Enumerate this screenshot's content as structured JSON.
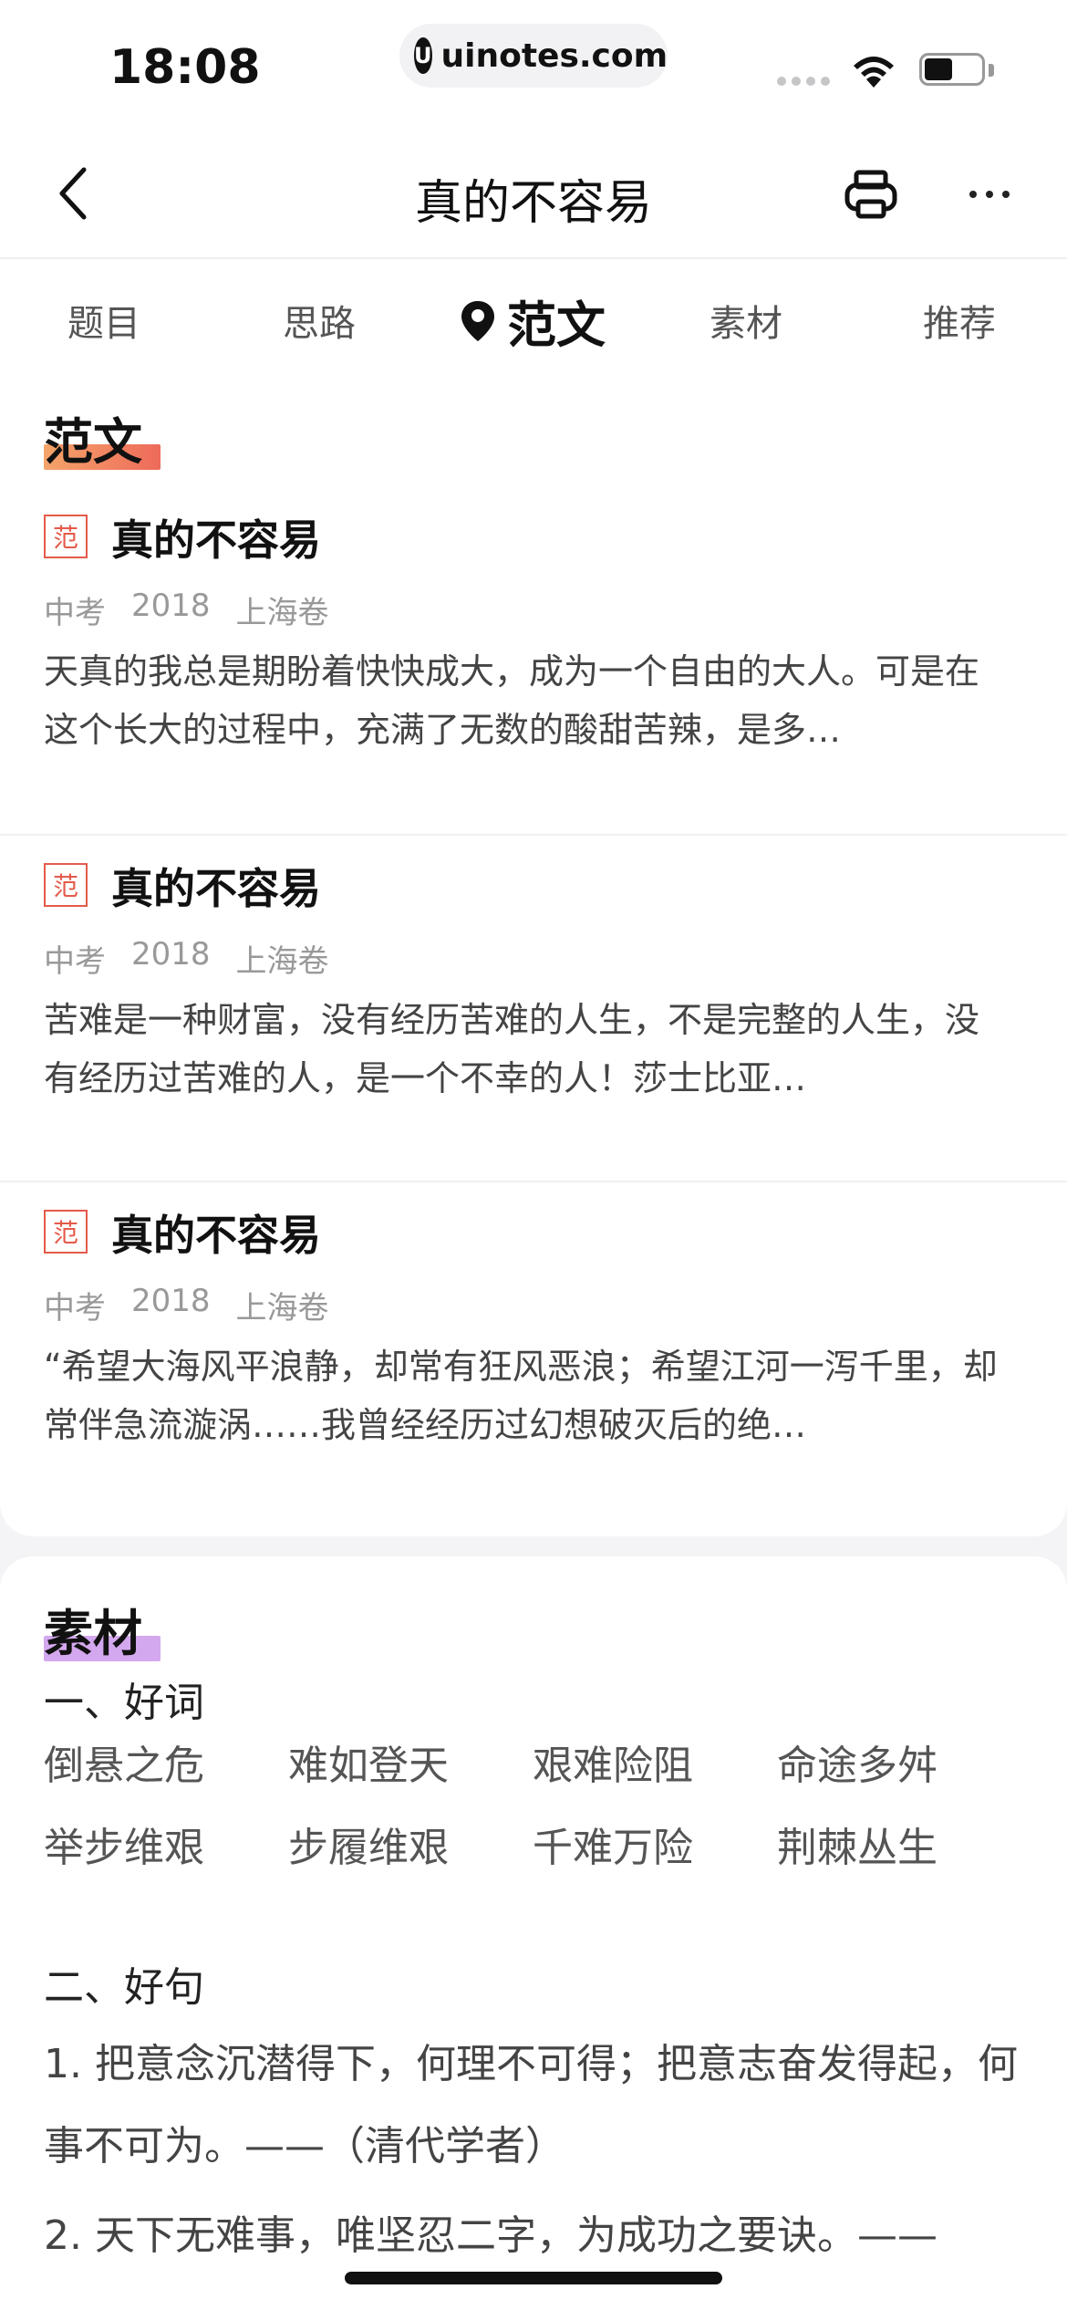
{
  "status_bar": {
    "time": "18:08",
    "url": "uinotes.com",
    "url_logo": "U",
    "battery_level": 0.5
  },
  "nav": {
    "title": "真的不容易",
    "back_icon": "chevron-left-icon",
    "print_icon": "printer-icon",
    "more_icon": "more-horizontal-icon"
  },
  "tabs": [
    {
      "label": "题目"
    },
    {
      "label": "思路"
    },
    {
      "label": "范文",
      "active": true,
      "icon": "location-pin-icon"
    },
    {
      "label": "素材"
    },
    {
      "label": "推荐"
    }
  ],
  "fanwen": {
    "heading": "范文",
    "highlight_color": "#f07a52",
    "essays": [
      {
        "badge": "范",
        "title": "真的不容易",
        "meta": [
          "中考",
          "2018",
          "上海卷"
        ],
        "excerpt": "天真的我总是期盼着快快成大，成为一个自由的大人。可是在这个长大的过程中，充满了无数的酸甜苦辣，是多…"
      },
      {
        "badge": "范",
        "title": "真的不容易",
        "meta": [
          "中考",
          "2018",
          "上海卷"
        ],
        "excerpt": "苦难是一种财富，没有经历苦难的人生，不是完整的人生，没有经历过苦难的人，是一个不幸的人！莎士比亚…"
      },
      {
        "badge": "范",
        "title": "真的不容易",
        "meta": [
          "中考",
          "2018",
          "上海卷"
        ],
        "excerpt": "“希望大海风平浪静，却常有狂风恶浪；希望江河一泻千里，却常伴急流漩涡……我曾经经历过幻想破灭后的绝…"
      }
    ]
  },
  "sucai": {
    "heading": "素材",
    "highlight_color": "#c79be8",
    "good_words_heading": "一、好词",
    "good_words": [
      "倒悬之危",
      "难如登天",
      "艰难险阻",
      "命途多舛",
      "举步维艰",
      "步履维艰",
      "千难万险",
      "荆棘丛生"
    ],
    "good_sentences_heading": "二、好句",
    "sentences": [
      "1. 把意念沉潜得下，何理不可得；把意志奋发得起，何事不可为。——（清代学者）",
      "2. 天下无难事，唯坚忍二字，为成功之要诀。——"
    ]
  }
}
